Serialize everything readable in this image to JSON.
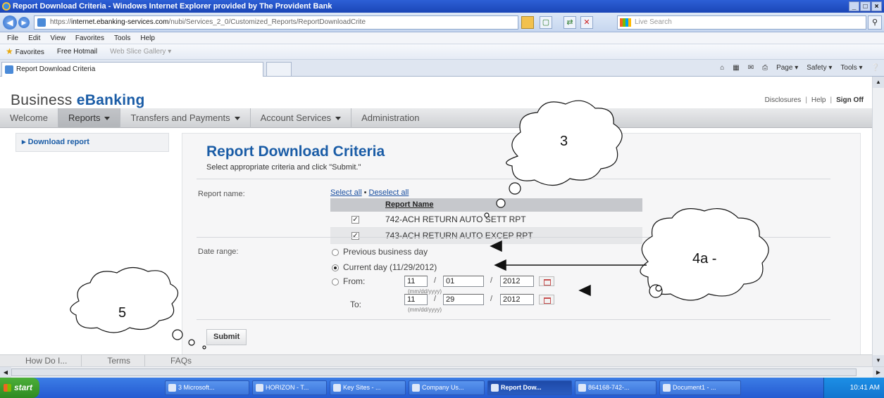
{
  "window": {
    "title": "Report Download Criteria - Windows Internet Explorer provided by The Provident Bank",
    "controls": [
      "_",
      "□",
      "×"
    ]
  },
  "address_bar": {
    "url_prefix": "https://",
    "url_host": "internet.ebanking-services.com",
    "url_path": "/nubi/Services_2_0/Customized_Reports/ReportDownloadCrite",
    "search_placeholder": "Live Search"
  },
  "menu": [
    "File",
    "Edit",
    "View",
    "Favorites",
    "Tools",
    "Help"
  ],
  "favorites_bar": {
    "favorites": "Favorites",
    "items": [
      "Free Hotmail",
      "Web Slice Gallery ▾"
    ]
  },
  "tab": {
    "title": "Report Download Criteria",
    "commands": [
      "Page ▾",
      "Safety ▾",
      "Tools ▾"
    ]
  },
  "site": {
    "brand_prefix": "Business ",
    "brand_accent": "eBanking",
    "links": [
      "Disclosures",
      "Help",
      "Sign Off"
    ],
    "nav": [
      {
        "label": "Welcome",
        "dropdown": false
      },
      {
        "label": "Reports",
        "dropdown": true
      },
      {
        "label": "Transfers and Payments",
        "dropdown": true
      },
      {
        "label": "Account Services",
        "dropdown": true
      },
      {
        "label": "Administration",
        "dropdown": false
      }
    ],
    "sidebar_link": "▸ Download report"
  },
  "form": {
    "heading": "Report Download Criteria",
    "instructions": "Select appropriate criteria and click \"Submit.\"",
    "report_name_label": "Report name:",
    "select_all": "Select all",
    "separator": "•",
    "deselect_all": "Deselect all",
    "table_header": "Report Name",
    "reports": [
      {
        "name": "742-ACH RETURN AUTO SETT RPT",
        "checked": true
      },
      {
        "name": "743-ACH RETURN AUTO EXCEP RPT",
        "checked": true
      }
    ],
    "date_range_label": "Date range:",
    "options": {
      "previous": "Previous business day",
      "current": "Current day (11/29/2012)",
      "from_label": "From:",
      "to_label": "To:"
    },
    "selected_option": "current",
    "from": {
      "month": "11",
      "day": "01",
      "year": "2012"
    },
    "to": {
      "month": "11",
      "day": "29",
      "year": "2012"
    },
    "date_sep": "/",
    "date_hint": "(mm/dd/yyyy)",
    "submit_label": "Submit"
  },
  "footer": [
    "How Do I...",
    "Terms",
    "FAQs"
  ],
  "taskbar": {
    "start": "start",
    "items": [
      {
        "label": "3 Microsoft...",
        "active": false
      },
      {
        "label": "HORIZON - T...",
        "active": false
      },
      {
        "label": "Key Sites - ...",
        "active": false
      },
      {
        "label": "Company Us...",
        "active": false
      },
      {
        "label": "Report Dow...",
        "active": true
      },
      {
        "label": "864168-742-...",
        "active": false
      },
      {
        "label": "Document1 - ...",
        "active": false
      }
    ],
    "clock": "10:41 AM"
  },
  "annotations": {
    "cloud_3": "3",
    "cloud_4a": "4a -",
    "cloud_5": "5"
  }
}
